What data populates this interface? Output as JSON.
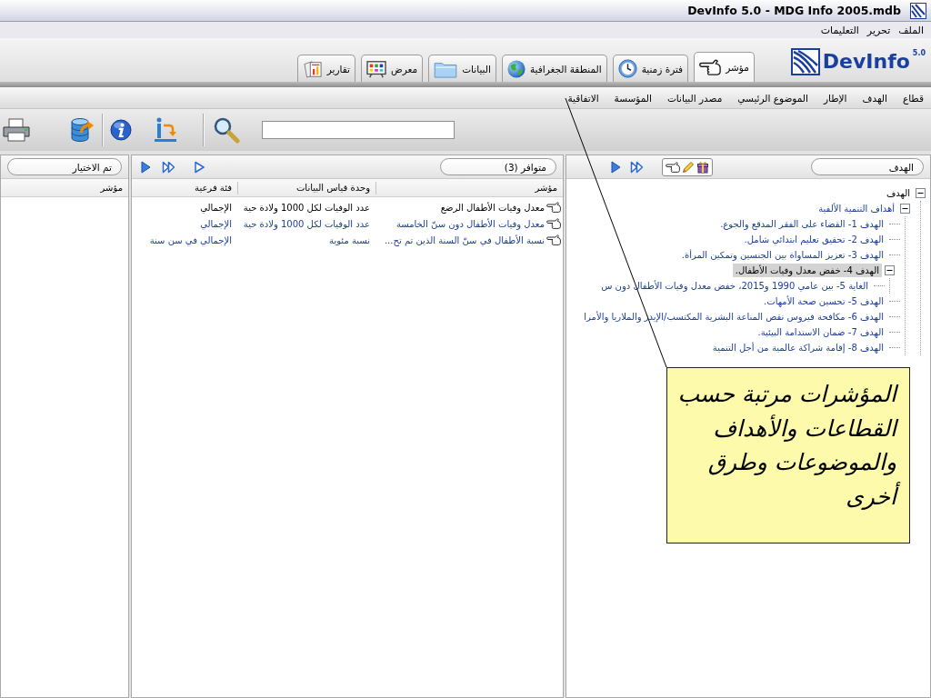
{
  "window": {
    "title": "DevInfo 5.0 - MDG Info 2005.mdb"
  },
  "menu": [
    "الملف",
    "تحرير",
    "التعليمات"
  ],
  "logo": {
    "name": "DevInfo",
    "version": "5.0"
  },
  "tabs": [
    {
      "label": "مؤشر",
      "selected": true
    },
    {
      "label": "فترة زمنية",
      "selected": false
    },
    {
      "label": "المنطقة الجغرافية",
      "selected": false
    },
    {
      "label": "البيانات",
      "selected": false
    },
    {
      "label": "معرض",
      "selected": false
    },
    {
      "label": "تقارير",
      "selected": false
    }
  ],
  "categories": [
    "قطاع",
    "الهدف",
    "الإطار",
    "الموضوع الرئيسي",
    "مصدر البيانات",
    "المؤسسة",
    "الاتفاقية"
  ],
  "classification_panel": {
    "title": "الهدف",
    "tree": [
      {
        "label": "الهدف",
        "expanded": true,
        "selected": false,
        "children": [
          {
            "label": "أهداف التنمية الألفية",
            "expanded": true,
            "selected": false,
            "children": [
              {
                "label": "الهدف 1- القضاء على الفقر المدقع والجوع.",
                "selected": false
              },
              {
                "label": "الهدف 2- تحقيق تعليم ابتدائي شامل.",
                "selected": false
              },
              {
                "label": "الهدف 3- تعزيز المساواة بين الجنسين وتمكين المرأة.",
                "selected": false
              },
              {
                "label": "الهدف 4- خفض معدل وفيات الأطفال.",
                "expanded": true,
                "selected": true,
                "children": [
                  {
                    "label": "الغاية 5- بين عامي 1990 و2015، خفض معدل وفيات الأطفال دون س",
                    "selected": false
                  }
                ]
              },
              {
                "label": "الهدف 5- تحسين صحة الأمهات.",
                "selected": false
              },
              {
                "label": "الهدف 6- مكافحة فيروس نقص المناعة البشرية المكتسب/الإيدز والملاريا والأمرا",
                "selected": false
              },
              {
                "label": "الهدف 7- ضمان الاستدامة البيئية.",
                "selected": false
              },
              {
                "label": "الهدف 8- إقامة شراكة عالمية من أجل التنمية",
                "selected": false
              }
            ]
          }
        ]
      }
    ]
  },
  "available_panel": {
    "title": "متوافر (3)",
    "columns": [
      "مؤشر",
      "وحدة قياس البيانات",
      "فئة فرعية"
    ],
    "rows": [
      {
        "indicator": "معدل وفيات الأطفال الرضع",
        "unit": "عدد الوفيات لكل 1000 ولادة حية",
        "subgroup": "الإجمالي",
        "selected": true
      },
      {
        "indicator": "معدل وفيات الأطفال دون سنّ الخامسة",
        "unit": "عدد الوفيات لكل 1000 ولادة حية",
        "subgroup": "الإجمالي",
        "selected": false
      },
      {
        "indicator": "نسبة الأطفال في سنّ السنة الذين تم تح...",
        "unit": "نسبة مئوية",
        "subgroup": "الإجمالي في سن سنة",
        "selected": false
      }
    ]
  },
  "selected_panel": {
    "title": "تم الاختيار",
    "columns": [
      "مؤشر"
    ]
  },
  "callout": {
    "text": "المؤشرات مرتبة حسب القطاعات والأهداف والموضوعات وطرق أخرى"
  }
}
